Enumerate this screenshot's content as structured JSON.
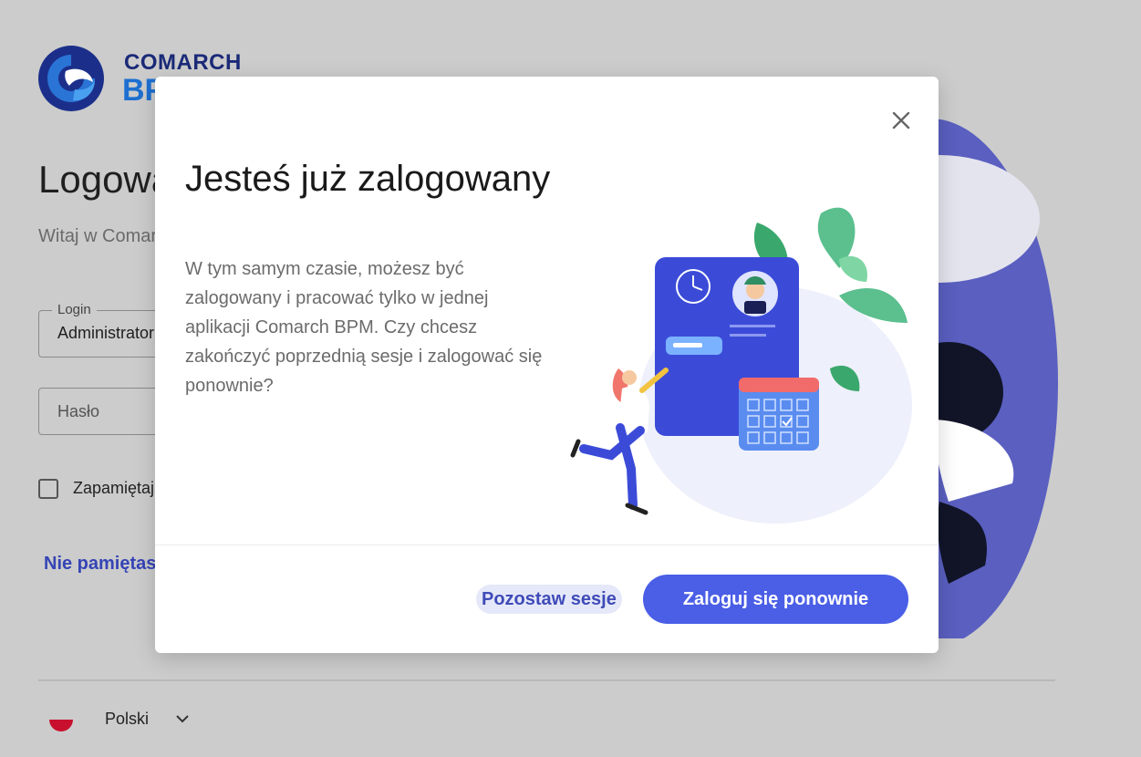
{
  "brand": {
    "name_top": "COMARCH",
    "name_bottom": "BPM"
  },
  "login": {
    "title": "Logowanie",
    "subtitle": "Witaj w Comarch BPM",
    "login_legend": "Login",
    "login_value": "Administrator",
    "password_placeholder": "Hasło",
    "remember_label": "Zapamiętaj mnie",
    "forgot_link": "Nie pamiętasz hasła?"
  },
  "footer": {
    "language": "Polski"
  },
  "modal": {
    "title": "Jesteś już zalogowany",
    "body": "W tym samym czasie, możesz być zalogowany i pracować tylko w jednej aplikacji Comarch BPM. Czy chcesz zakończyć poprzednią sesje i zalogować się ponownie?",
    "stay_button": "Pozostaw sesje",
    "relogin_button": "Zaloguj się ponownie"
  },
  "colors": {
    "primary": "#4a5ee6",
    "brand_dark": "#1b2a78",
    "brand_blue": "#1d6fd1",
    "overlay": "#cccccc"
  },
  "icons": [
    "comarch-logo-icon",
    "close-icon",
    "chevron-down-icon",
    "flag-pl-icon",
    "checkbox-icon"
  ]
}
